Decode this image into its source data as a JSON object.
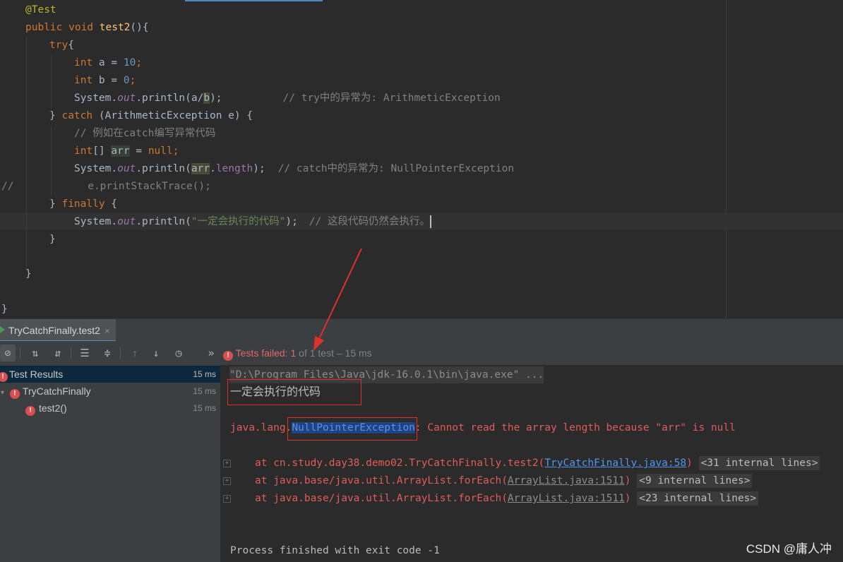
{
  "editor": {
    "lines": {
      "l1": "@Test",
      "l2_kw": "public void ",
      "l2_fn": "test2",
      "l2_rest": "(){",
      "l3_kw": "try",
      "l3_rest": "{",
      "l4_kw": "int ",
      "l4_mid": "a = ",
      "l4_num": "10",
      "l4_end": ";",
      "l5_kw": "int ",
      "l5_mid": "b = ",
      "l5_num": "0",
      "l5_end": ";",
      "l6_a": "System.",
      "l6_out": "out",
      "l6_b": ".println(a/",
      "l6_var": "b",
      "l6_c": ");",
      "l6_comment": "// try中的异常为: ArithmeticException",
      "l7_a": "} ",
      "l7_kw": "catch",
      "l7_b": " (ArithmeticException e) {",
      "l8_comment": "// 例如在catch编写异常代码",
      "l9_a": "int",
      "l9_b": "[] ",
      "l9_var": "arr",
      "l9_c": " = ",
      "l9_kw": "null",
      "l9_end": ";",
      "l10_a": "System.",
      "l10_out": "out",
      "l10_b": ".println(",
      "l10_var": "arr",
      "l10_c": ".",
      "l10_len": "length",
      "l10_d": ");",
      "l10_comment": "// catch中的异常为: NullPointerException",
      "l11_comment": "//            e.printStackTrace();",
      "l12_a": "} ",
      "l12_kw": "finally",
      "l12_b": " {",
      "l13_a": "System.",
      "l13_out": "out",
      "l13_b": ".println(",
      "l13_str": "\"一定会执行的代码\"",
      "l13_c": ");",
      "l13_comment": "// 这段代码仍然会执行。",
      "l14": "}",
      "l16": "}",
      "l18": "}"
    }
  },
  "run_tab": {
    "label": "TryCatchFinally.test2",
    "close": "×"
  },
  "toolbar": {
    "status_prefix": "Tests failed: ",
    "failed": "1",
    "of_label": " of ",
    "total": "1 test",
    "duration": " – 15 ms",
    "more": "»"
  },
  "tree": {
    "rows": [
      {
        "label": "Test Results",
        "time": "15 ms"
      },
      {
        "label": "TryCatchFinally",
        "time": "15 ms"
      },
      {
        "label": "test2()",
        "time": "15 ms"
      }
    ]
  },
  "console": {
    "cmd": "\"D:\\Program Files\\Java\\jdk-16.0.1\\bin\\java.exe\" ...",
    "output": "一定会执行的代码",
    "exc_pkg": "java.lang.",
    "exc_name": "NullPointerException",
    "exc_msg": ": Cannot read the array length because \"arr\" is null",
    "st1_pre": "at cn.study.day38.demo02.TryCatchFinally.test2(",
    "st1_link": "TryCatchFinally.java:58",
    "st1_post": ")",
    "st1_internal": "<31 internal lines>",
    "st2_pre": "at java.base/java.util.ArrayList.forEach(",
    "st2_link": "ArrayList.java:1511",
    "st2_post": ")",
    "st2_internal": "<9 internal lines>",
    "st3_pre": "at java.base/java.util.ArrayList.forEach(",
    "st3_link": "ArrayList.java:1511",
    "st3_post": ")",
    "st3_internal": "<23 internal lines>",
    "exit": "Process finished with exit code -1"
  },
  "watermark": "CSDN @庸人冲"
}
